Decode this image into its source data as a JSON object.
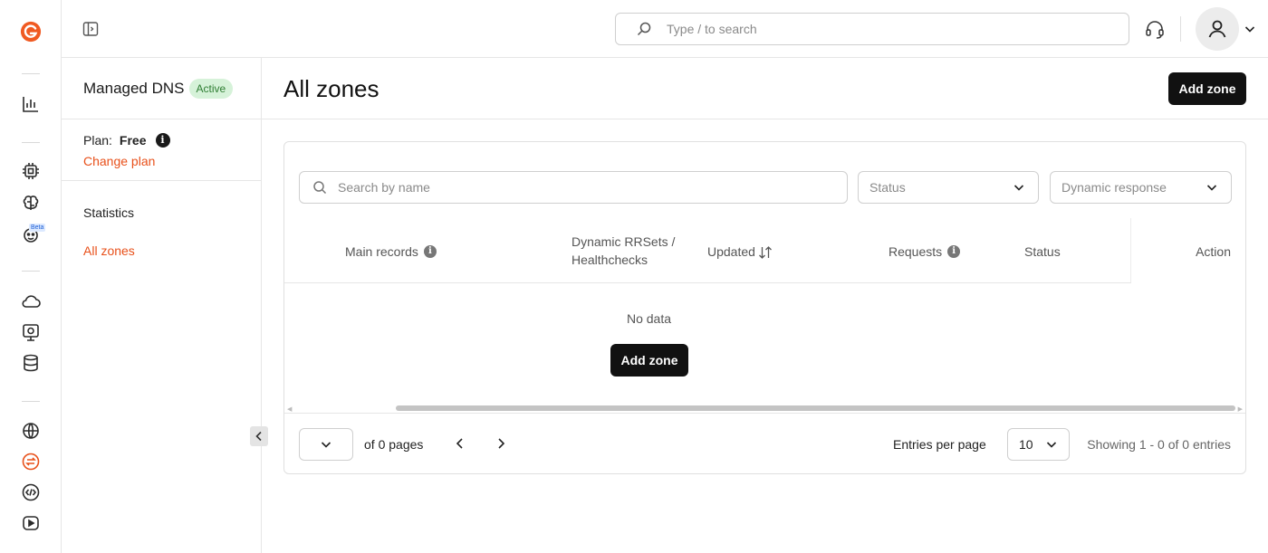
{
  "topbar": {
    "search_placeholder": "Type / to search"
  },
  "sidebar": {
    "product": "Managed DNS",
    "status_badge": "Active",
    "plan_label": "Plan:",
    "plan_value": "Free",
    "change_plan": "Change plan",
    "nav": [
      {
        "label": "Statistics",
        "active": false
      },
      {
        "label": "All zones",
        "active": true
      }
    ]
  },
  "rail": {
    "beta_label": "Beta",
    "icons": [
      "gcore-logo-icon",
      "statistics-icon",
      "cpu-chip-icon",
      "ai-brain-icon",
      "ai-bot-icon",
      "cloud-icon",
      "monitor-icon",
      "database-icon",
      "globe-icon",
      "dns-icon",
      "code-icon",
      "video-icon"
    ]
  },
  "main": {
    "title": "All zones",
    "add_zone_label": "Add zone"
  },
  "filters": {
    "search_placeholder": "Search by name",
    "status_placeholder": "Status",
    "dynamic_placeholder": "Dynamic response"
  },
  "table": {
    "columns": {
      "main_records": "Main records",
      "dynamic": "Dynamic RRSets / Healthchecks",
      "updated": "Updated",
      "requests": "Requests",
      "status": "Status",
      "action": "Action"
    },
    "empty_text": "No data",
    "empty_button": "Add zone"
  },
  "pagination": {
    "page_value": "",
    "of_pages": "of 0 pages",
    "entries_label": "Entries per page",
    "entries_value": "10",
    "showing": "Showing 1 - 0 of 0 entries"
  },
  "colors": {
    "accent": "#e8501a",
    "dark_button": "#111111",
    "active_badge_bg": "#d6f2d9"
  }
}
